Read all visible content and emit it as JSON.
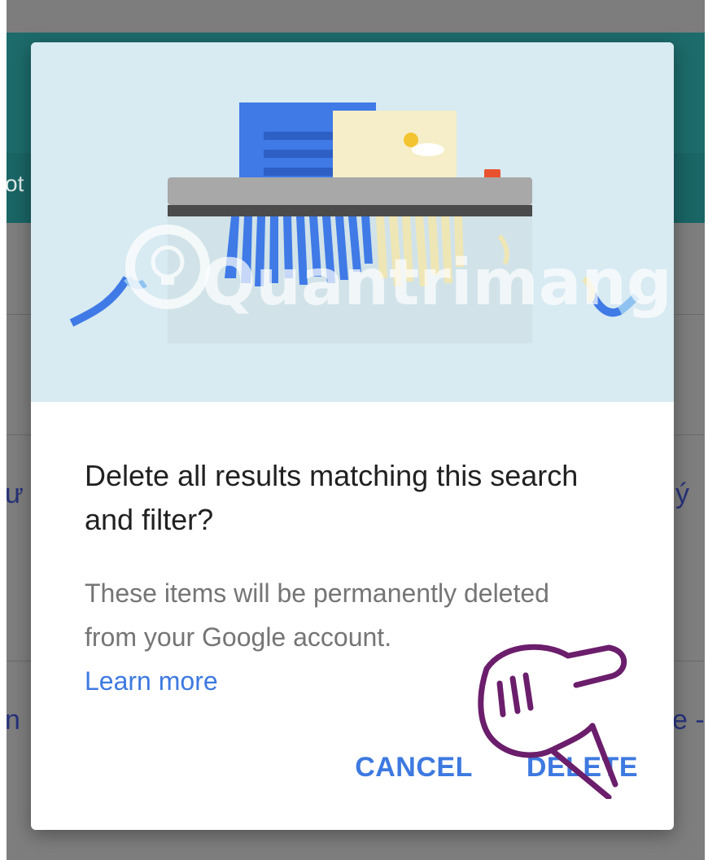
{
  "background": {
    "header_fragment": "ot",
    "left_fragment_1": "ư",
    "right_fragment_1": "ý",
    "left_fragment_2": "n",
    "right_fragment_2": "e -"
  },
  "dialog": {
    "illustration": "shredder-illustration",
    "title": "Delete all results matching this search and filter?",
    "body": "These items will be permanently deleted from your Google account.",
    "learn_more": "Learn more",
    "cancel_label": "CANCEL",
    "delete_label": "DELETE"
  },
  "colors": {
    "accent": "#3d79e0",
    "hero_background": "#d8eaf2",
    "app_header": "#1d6b6b"
  },
  "overlay": {
    "watermark": "Quantrimang",
    "pointer_icon": "pointing-hand-icon"
  }
}
